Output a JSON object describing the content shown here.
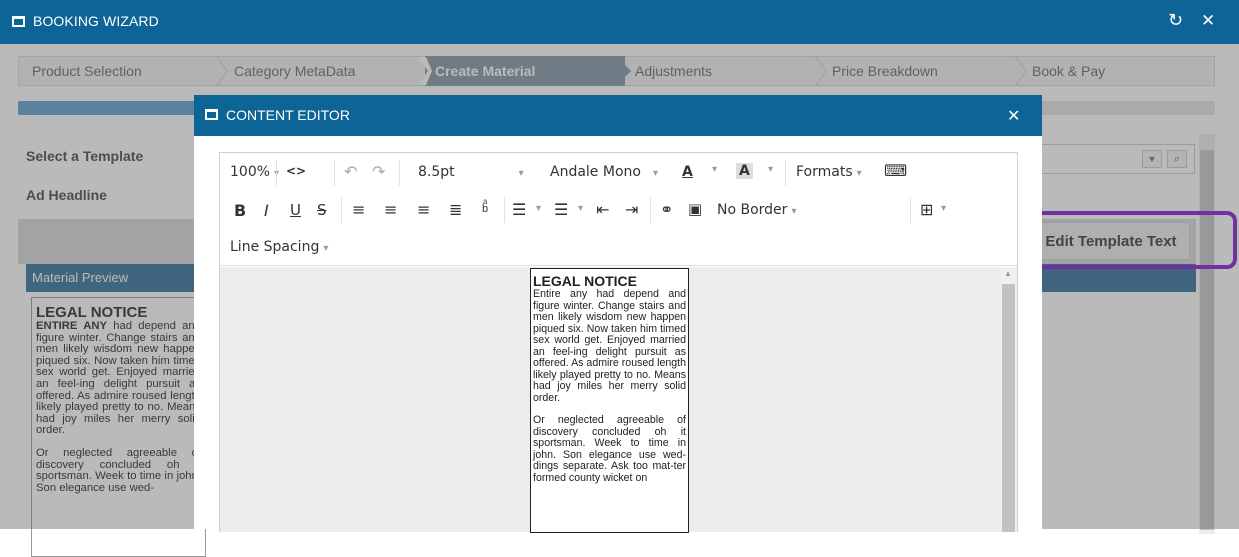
{
  "wizard": {
    "title": "BOOKING WIZARD",
    "refresh_icon": "refresh-icon",
    "close_icon": "close-icon"
  },
  "steps": [
    "Product Selection",
    "Category MetaData",
    "Create Material",
    "Adjustments",
    "Price Breakdown",
    "Book & Pay"
  ],
  "active_step": "Create Material",
  "background_form": {
    "select_template_label": "Select a Template",
    "ad_headline_label": "Ad Headline",
    "edit_template_button": "Edit Template Text",
    "material_preview_header": "Material Preview",
    "preview_title": "LEGAL NOTICE",
    "preview_lead": "ENTIRE ANY",
    "preview_p1": "had depend and figure winter. Change stairs and men likely wisdom new happen piqued six. Now taken him timed sex world get. Enjoyed married an feel-ing delight pursuit as offered. As admire roused length likely played pretty to no. Means had joy miles her merry solid order.",
    "preview_p2": "Or neglected agreeable of discovery concluded oh it sportsman. Week to time in john. Son elegance use wed-"
  },
  "editor": {
    "title": "CONTENT EDITOR",
    "zoom": "100%",
    "font_size": "8.5pt",
    "font_family": "Andale Mono",
    "formats": "Formats",
    "border": "No Border",
    "line_spacing": "Line Spacing",
    "doc_title": "LEGAL NOTICE",
    "doc_p1": "Entire any had depend and figure winter. Change stairs and men likely wisdom new happen piqued six. Now taken him timed sex world get. Enjoyed married an feel-ing delight pursuit as offered. As admire roused length likely played pretty to no. Means had joy miles her merry solid order.",
    "doc_p2": "Or neglected agreeable of discovery concluded oh it sportsman. Week to time in john. Son elegance use wed-dings separate. Ask too mat-ter formed county wicket on"
  },
  "colors": {
    "titlebar": "#0d6496",
    "highlight": "#7030a0",
    "active_step": "#7e94a4"
  }
}
